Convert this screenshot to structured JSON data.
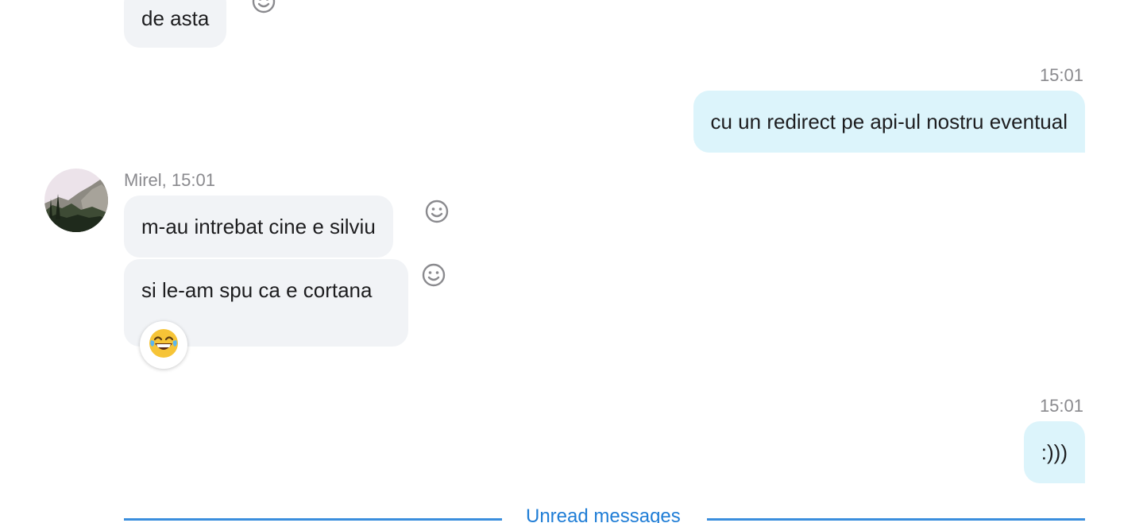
{
  "messages": [
    {
      "direction": "in",
      "text": "de asta"
    },
    {
      "direction": "out",
      "time": "15:01",
      "text": "cu un redirect pe api-ul nostru eventual"
    },
    {
      "direction": "in",
      "sender": "Mirel, 15:01",
      "text": "m-au intrebat cine e silviu"
    },
    {
      "direction": "in",
      "text": "si le-am spu ca e cortana",
      "reaction": "laughing-with-tears-emoji"
    },
    {
      "direction": "out",
      "time": "15:01",
      "text": ":)))"
    }
  ],
  "divider": {
    "label": "Unread messages"
  },
  "colors": {
    "incoming_bubble": "#f1f3f6",
    "outgoing_bubble": "#dcf4fb",
    "meta_text": "#8a8a8e",
    "divider": "#3a8edd"
  }
}
